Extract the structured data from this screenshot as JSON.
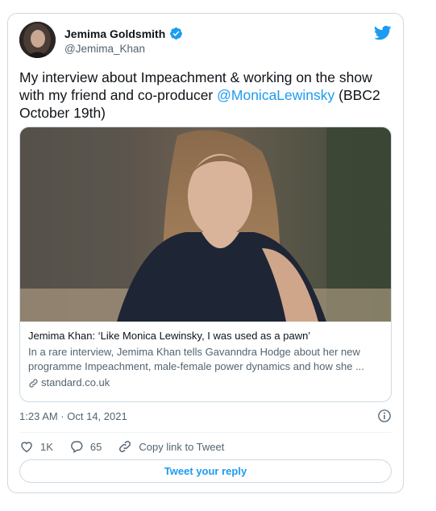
{
  "author": {
    "name": "Jemima Goldsmith",
    "handle": "@Jemima_Khan",
    "verified": true
  },
  "tweet": {
    "text_before": "My interview about Impeachment & working on the show with my friend and co-producer ",
    "mention": "@MonicaLewinsky",
    "text_after": " (BBC2 October 19th)",
    "timestamp": "1:23 AM · Oct 14, 2021"
  },
  "link_card": {
    "title": "Jemima Khan: ‘Like Monica Lewinsky, I was used as a pawn’",
    "description": "In a rare interview, Jemima Khan tells Gavanndra Hodge about her new programme Impeachment, male-female power dynamics and how she ...",
    "domain": "standard.co.uk"
  },
  "actions": {
    "likes": "1K",
    "replies": "65",
    "copy_link": "Copy link to Tweet"
  },
  "reply_button": "Tweet your reply",
  "colors": {
    "accent": "#1d9bf0",
    "text": "#0f1419",
    "muted": "#536471",
    "border": "#cfd9de"
  },
  "icons": [
    "verified-badge-icon",
    "twitter-bird-icon",
    "link-icon",
    "info-icon",
    "heart-icon",
    "reply-bubble-icon",
    "copy-link-icon"
  ]
}
